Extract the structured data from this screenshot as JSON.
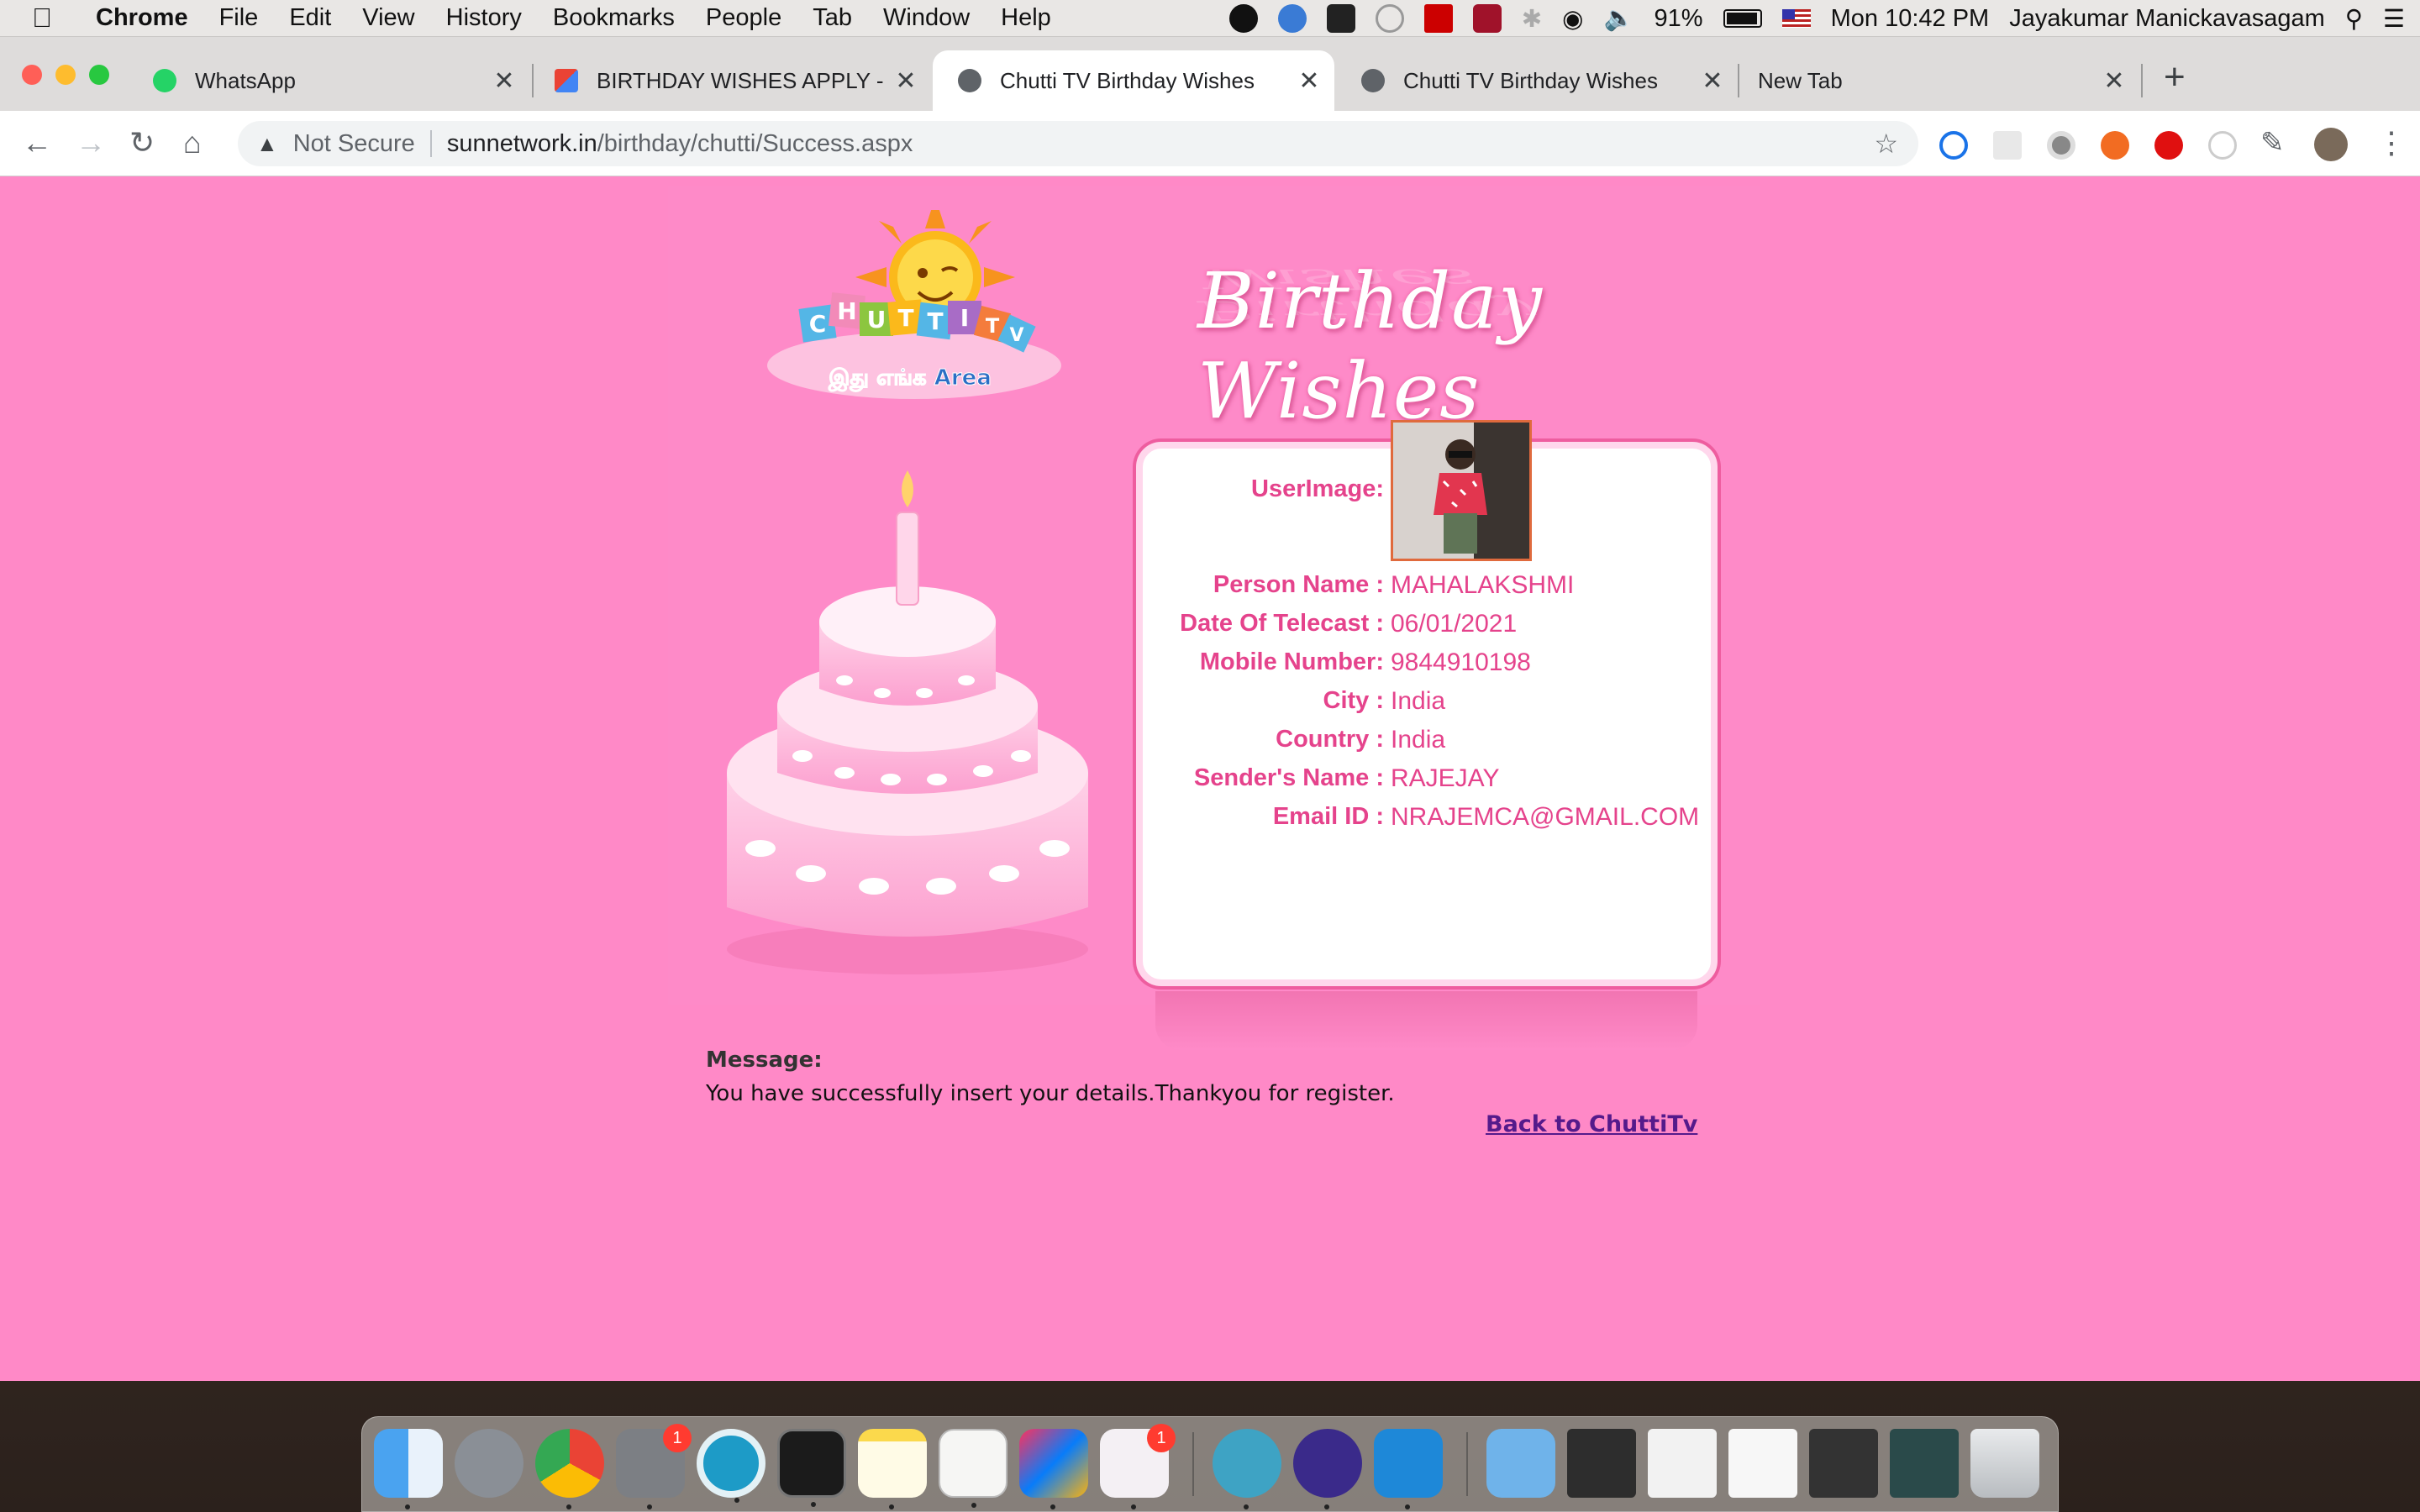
{
  "menubar": {
    "app_name": "Chrome",
    "menus": [
      "File",
      "Edit",
      "View",
      "History",
      "Bookmarks",
      "People",
      "Tab",
      "Window",
      "Help"
    ],
    "battery": "91%",
    "clock": "Mon 10:42 PM",
    "user": "Jayakumar Manickavasagam"
  },
  "tabs": [
    {
      "title": "WhatsApp",
      "icon": "whatsapp-icon"
    },
    {
      "title": "BIRTHDAY WISHES APPLY - nr",
      "icon": "gmail-icon"
    },
    {
      "title": "Chutti TV Birthday Wishes",
      "icon": "globe-icon",
      "active": true
    },
    {
      "title": "Chutti TV Birthday Wishes",
      "icon": "globe-icon"
    },
    {
      "title": "New Tab",
      "icon": ""
    }
  ],
  "address": {
    "security": "Not Secure",
    "domain": "sunnetwork.in",
    "path": "/birthday/chutti/Success.aspx"
  },
  "page": {
    "heading": "Birthday Wishes",
    "fields": [
      {
        "label": "UserImage:",
        "value": ""
      },
      {
        "label": "Person Name :",
        "value": "MAHALAKSHMI"
      },
      {
        "label": "Date Of Telecast :",
        "value": "06/01/2021"
      },
      {
        "label": "Mobile Number:",
        "value": "9844910198"
      },
      {
        "label": "City :",
        "value": "India"
      },
      {
        "label": "Country :",
        "value": "India"
      },
      {
        "label": "Sender's Name :",
        "value": "RAJEJAY"
      },
      {
        "label": "Email ID :",
        "value": "NRAJEMCA@GMAIL.COM"
      }
    ],
    "message_label": "Message:",
    "message_text": "You have successfully insert your details.Thankyou for register.",
    "back_link": "Back to ChuttiTv"
  },
  "logo": {
    "letters": [
      "C",
      "H",
      "U",
      "T",
      "T",
      "I",
      "T",
      "V"
    ],
    "tagline": "இது எங்க Area"
  },
  "dock": {
    "badges": {
      "system-preferences": "1",
      "slack": "1"
    }
  },
  "colors": {
    "page_bg": "#ff89c7",
    "label_pink": "#e5438c",
    "link": "#551a8b"
  }
}
